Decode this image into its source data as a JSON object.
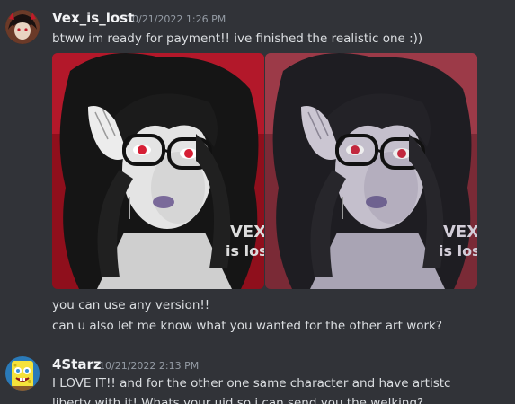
{
  "messages": [
    {
      "username": "Vex_is_lost",
      "timestamp": "10/21/2022 1:26 PM",
      "lines": [
        "btww im ready for payment!! ive finished the realistic one :))",
        "you can use any version!!",
        "can u also let me know what you wanted for the other art work?"
      ],
      "attachments": [
        {
          "watermark_top": "VEX",
          "watermark_bottom": "is los"
        },
        {
          "watermark_top": "VEX",
          "watermark_bottom": "is los"
        }
      ]
    },
    {
      "username": "4Starz",
      "timestamp": "10/21/2022 2:13 PM",
      "lines": [
        "I LOVE IT!! and for the other one same character and have artistc",
        "liberty with it! Whats your uid so i can send you the welking?"
      ]
    }
  ],
  "colors": {
    "background": "#313338",
    "text": "#dbdee1",
    "username": "#f2f3f5",
    "timestamp": "#949ba4",
    "art_accent_red": "#a8101e"
  }
}
